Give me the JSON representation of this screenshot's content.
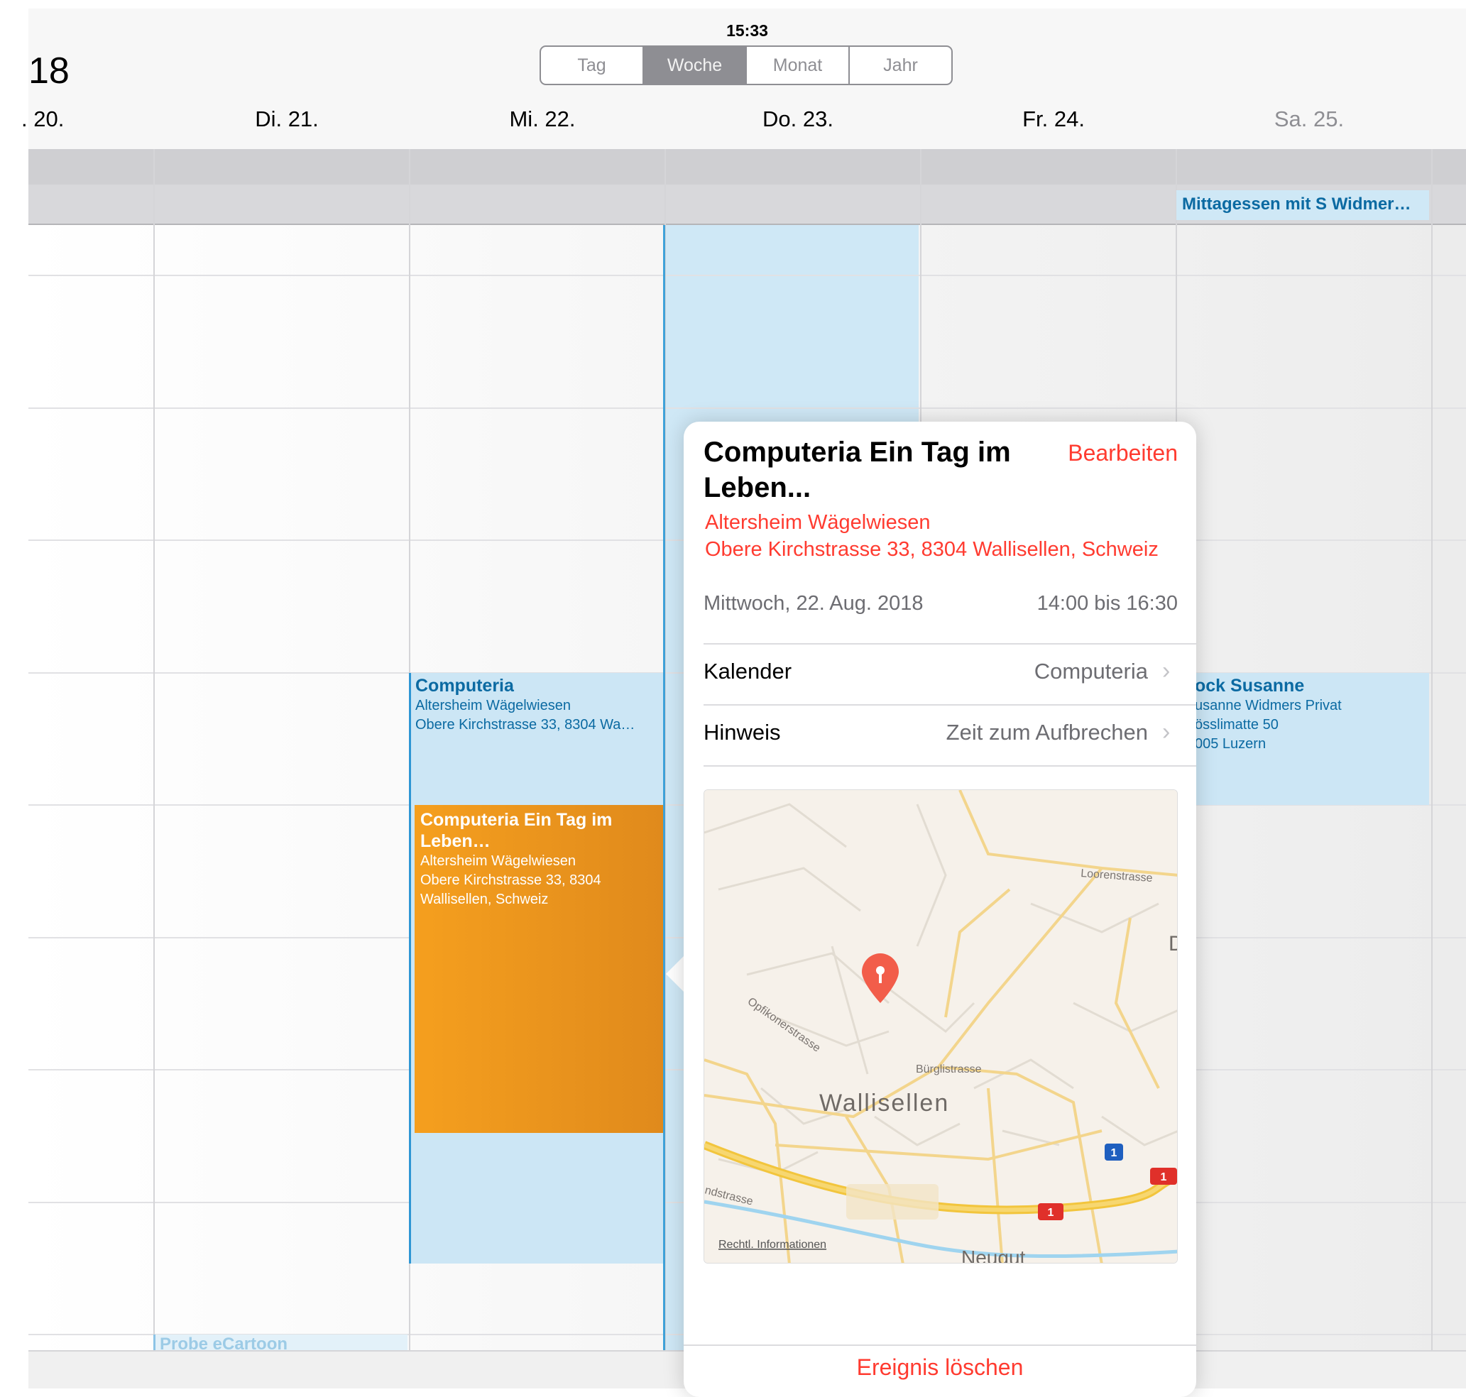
{
  "status": {
    "time": "15:33"
  },
  "header": {
    "year_fragment": "18",
    "segments": [
      "Tag",
      "Woche",
      "Monat",
      "Jahr"
    ],
    "active_segment": "Woche",
    "days": [
      ". 20.",
      "Di. 21.",
      "Mi. 22.",
      "Do. 23.",
      "Fr. 24.",
      "Sa. 25."
    ]
  },
  "allday": {
    "sat_event": "Mittagessen mit S Widmer…"
  },
  "events": {
    "wed1": {
      "title": "Computeria",
      "line1": "Altersheim Wägelwiesen",
      "line2": "Obere Kirchstrasse 33, 8304 Wa…"
    },
    "wed2": {
      "title": "Computeria Ein Tag im Leben…",
      "line1": "Altersheim Wägelwiesen",
      "line2": "Obere Kirchstrasse 33, 8304",
      "line3": "Wallisellen, Schweiz"
    },
    "sat": {
      "title": "ock Susanne",
      "line1": "usanne Widmers Privat",
      "line2": "össlimatte 50",
      "line3": "005 Luzern"
    },
    "tue": {
      "title": "Probe eCartoon"
    }
  },
  "popover": {
    "title": "Computeria Ein Tag im Leben...",
    "edit_label": "Bearbeiten",
    "location_name": "Altersheim Wägelwiesen",
    "location_address": "Obere Kirchstrasse 33, 8304 Wallisellen, Schweiz",
    "date": "Mittwoch, 22. Aug. 2018",
    "time": "14:00 bis 16:30",
    "calendar_label": "Kalender",
    "calendar_value": "Computeria",
    "alert_label": "Hinweis",
    "alert_value": "Zeit zum Aufbrechen",
    "delete_label": "Ereignis löschen",
    "calendar_color": "#ff9500"
  },
  "map": {
    "labels": {
      "loorenstrasse": "Loorenstrasse",
      "opfikonerstrasse": "Opfikonerstrasse",
      "buerglistrasse": "Bürglistrasse",
      "wallisellen": "Wallisellen",
      "ndstrasse": "ndstrasse",
      "neugut": "Neugut",
      "legal": "Rechtl. Informationen",
      "edge_letter": "D"
    },
    "shields": {
      "blue": "1",
      "red1": "1",
      "red2": "1"
    }
  }
}
